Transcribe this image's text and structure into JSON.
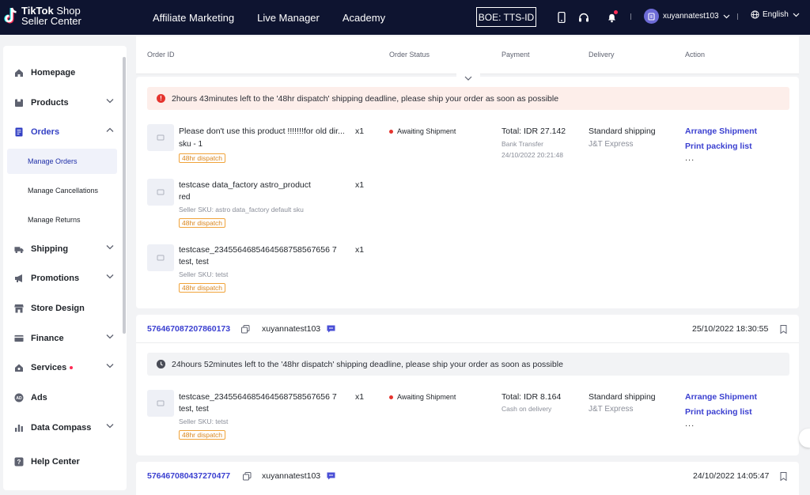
{
  "brand": {
    "line1_bold": "TikTok",
    "line1_rest": " Shop",
    "line2": "Seller Center"
  },
  "topnav": [
    "Affiliate Marketing",
    "Live Manager",
    "Academy"
  ],
  "env_badge": "BOE: TTS-ID",
  "user": {
    "name": "xuyannatest103"
  },
  "language": "English",
  "sidebar": {
    "items": [
      {
        "label": "Homepage",
        "icon": "home-icon"
      },
      {
        "label": "Products",
        "icon": "box-icon"
      },
      {
        "label": "Orders",
        "icon": "orders-icon"
      },
      {
        "label": "Shipping",
        "icon": "truck-icon"
      },
      {
        "label": "Promotions",
        "icon": "megaphone-icon"
      },
      {
        "label": "Store Design",
        "icon": "store-icon"
      },
      {
        "label": "Finance",
        "icon": "card-icon"
      },
      {
        "label": "Services",
        "icon": "services-icon"
      },
      {
        "label": "Ads",
        "icon": "ads-icon"
      },
      {
        "label": "Data Compass",
        "icon": "chart-icon"
      },
      {
        "label": "Help Center",
        "icon": "help-icon"
      }
    ],
    "orders_sub": [
      "Manage Orders",
      "Manage Cancellations",
      "Manage Returns"
    ]
  },
  "table_header": {
    "order_id": "Order ID",
    "status": "Order Status",
    "payment": "Payment",
    "delivery": "Delivery",
    "action": "Action"
  },
  "orders": [
    {
      "alert": "2hours 43minutes left to the '48hr dispatch' shipping deadline, please ship your order as soon as possible",
      "products": [
        {
          "name": "Please don't use this product !!!!!!!for old dir...",
          "variant": "sku - 1",
          "sku": "",
          "qty": "x1",
          "tag": "48hr dispatch"
        },
        {
          "name": "testcase data_factory astro_product",
          "variant": "red",
          "sku": "Seller SKU: astro data_factory default sku",
          "qty": "x1",
          "tag": "48hr dispatch"
        },
        {
          "name": "testcase_2345564685464568758567656 7",
          "variant": "test, test",
          "sku": "Seller SKU: tetst",
          "qty": "x1",
          "tag": "48hr dispatch"
        }
      ],
      "status": "Awaiting Shipment",
      "payment_total": "Total: IDR 27.142",
      "payment_method": "Bank Transfer",
      "payment_time": "24/10/2022 20:21:48",
      "shipping": "Standard shipping",
      "carrier": "J&T Express",
      "actions": [
        "Arrange Shipment",
        "Print packing list",
        "..."
      ]
    },
    {
      "order_id": "576467087207860173",
      "buyer": "xuyannatest103",
      "time": "25/10/2022 18:30:55",
      "alert": "24hours 52minutes left to the '48hr dispatch' shipping deadline, please ship your order as soon as possible",
      "products": [
        {
          "name": "testcase_2345564685464568758567656 7",
          "variant": "test, test",
          "sku": "Seller SKU: tetst",
          "qty": "x1",
          "tag": "48hr dispatch"
        }
      ],
      "status": "Awaiting Shipment",
      "payment_total": "Total: IDR 8.164",
      "payment_method": "Cash on delivery",
      "shipping": "Standard shipping",
      "carrier": "J&T Express",
      "actions": [
        "Arrange Shipment",
        "Print packing list",
        "..."
      ]
    },
    {
      "order_id": "576467080437270477",
      "buyer": "xuyannatest103",
      "time": "24/10/2022 14:05:47"
    }
  ],
  "colors": {
    "topbar": "#0e1430",
    "accent": "#3a3fd0",
    "alert_red": "#fdeeea",
    "tag_orange": "#f0a33a"
  }
}
